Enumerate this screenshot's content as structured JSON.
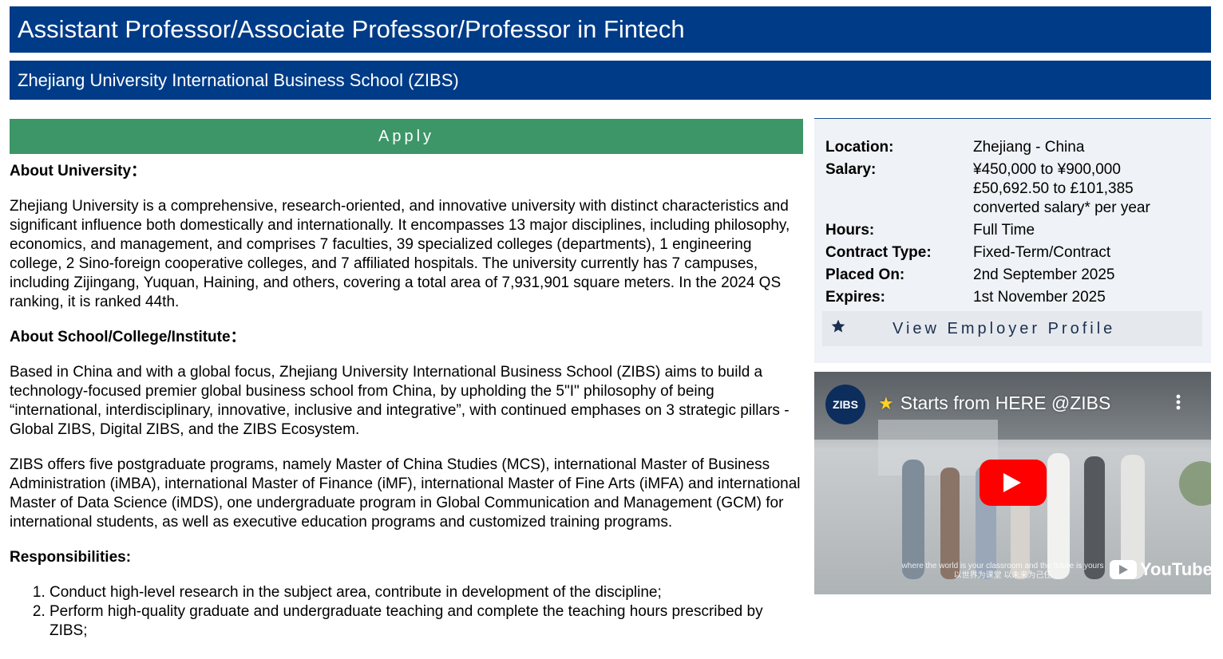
{
  "job": {
    "title": "Assistant Professor/Associate Professor/Professor in Fintech",
    "employer": "Zhejiang University International Business School (ZIBS)",
    "apply_label": "Apply"
  },
  "content": {
    "about_university_heading": "About University：",
    "about_university_text": "Zhejiang University is a comprehensive, research-oriented, and innovative university with distinct characteristics and significant influence both domestically and internationally. It encompasses 13 major disciplines, including philosophy, economics, and management, and comprises 7 faculties, 39 specialized colleges (departments), 1 engineering college, 2 Sino-foreign cooperative colleges, and 7 affiliated hospitals. The university currently has 7 campuses, including Zijingang, Yuquan, Haining, and others, covering a total area of 7,931,901 square meters. In the 2024 QS ranking, it is ranked 44th.",
    "about_school_heading": "About School/College/Institute：",
    "about_school_text": "Based in China and with a global focus, Zhejiang University International Business School (ZIBS) aims to build a technology-focused premier global business school from China, by upholding the 5\"I\" philosophy of being “international, interdisciplinary, innovative, inclusive and integrative”, with continued emphases on 3 strategic pillars - Global ZIBS, Digital ZIBS, and the ZIBS Ecosystem.",
    "programs_text": "ZIBS offers five postgraduate programs, namely Master of China Studies (MCS), international Master of Business Administration (iMBA), international Master of Finance (iMF), international Master of Fine Arts (iMFA) and international Master of Data Science (iMDS), one undergraduate program in Global Communication and Management (GCM) for international students, as well as executive education programs and customized training programs.",
    "responsibilities_heading": "Responsibilities:",
    "responsibilities": [
      "Conduct high-level research in the subject area, contribute in development of the discipline;",
      "Perform high-quality graduate and undergraduate teaching and complete the teaching hours prescribed by ZIBS;"
    ]
  },
  "sidebar": {
    "location_label": "Location:",
    "location_value": "Zhejiang - China",
    "salary_label": "Salary:",
    "salary_cny": "¥450,000 to ¥900,000",
    "salary_gbp": "£50,692.50 to £101,385",
    "salary_note": "converted salary* per year",
    "hours_label": "Hours:",
    "hours_value": "Full Time",
    "contract_label": "Contract Type:",
    "contract_value": "Fixed-Term/Contract",
    "placed_label": "Placed On:",
    "placed_value": "2nd September 2025",
    "expires_label": "Expires:",
    "expires_value": "1st November 2025",
    "view_profile_label": "View Employer Profile",
    "view_profile_icon": "star-icon"
  },
  "video": {
    "channel_logo": "ZIBS",
    "emoji_icon": "star-struck-emoji-icon",
    "title": "Starts from HERE @ZIBS",
    "caption_en": "where the world is your classroom and the future is yours",
    "caption_zh": "以世界为课堂 以未来为己任",
    "brand": "YouTube",
    "play_color": "#ff0000"
  },
  "colors": {
    "header_blue": "#003b87",
    "apply_green": "#3d9668",
    "sidebar_bg": "#eff2f6",
    "profile_text": "#1b2f4f"
  }
}
